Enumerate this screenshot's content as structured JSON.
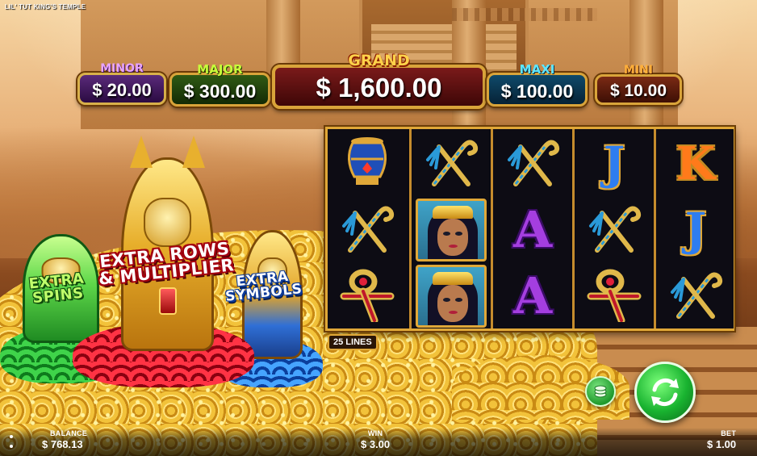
{
  "game": {
    "title": "LIL' TUT KING'S TEMPLE"
  },
  "jackpots": {
    "minor": {
      "label": "MINOR",
      "value": "$ 20.00"
    },
    "major": {
      "label": "MAJOR",
      "value": "$ 300.00"
    },
    "grand": {
      "label": "GRAND",
      "value": "$ 1,600.00"
    },
    "maxi": {
      "label": "MAXI",
      "value": "$ 100.00"
    },
    "mini": {
      "label": "MINI",
      "value": "$ 10.00"
    }
  },
  "features": {
    "extra_spins": "EXTRA SPINS",
    "extra_rows_multiplier": "EXTRA ROWS & MULTIPLIER",
    "extra_symbols": "EXTRA SYMBOLS"
  },
  "reels": {
    "lines_label": "25 LINES",
    "grid": [
      [
        "vase",
        "crook-flail",
        "ankh"
      ],
      [
        "crook-flail",
        "queen",
        "queen"
      ],
      [
        "crook-flail",
        "A",
        "A"
      ],
      [
        "J",
        "crook-flail",
        "ankh"
      ],
      [
        "K",
        "J",
        "crook-flail"
      ]
    ]
  },
  "footer": {
    "balance_label": "BALANCE",
    "balance_value": "$ 768.13",
    "win_label": "WIN",
    "win_value": "$ 3.00",
    "bet_label": "BET",
    "bet_value": "$ 1.00"
  },
  "icons": {
    "menu": "vertical-dots-icon",
    "bet": "coin-stack-icon",
    "spin": "refresh-arrows-icon"
  },
  "colors": {
    "reel_frame": "#e0a838",
    "spin_button": "#19b330",
    "grand_label": "#ffd24a"
  }
}
